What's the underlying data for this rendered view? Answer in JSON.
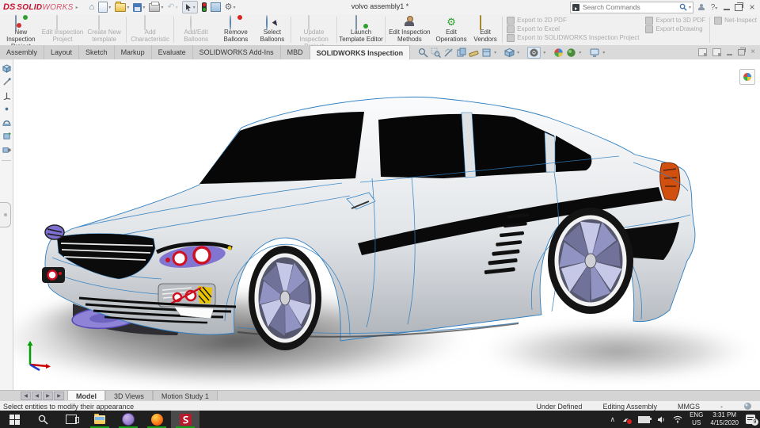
{
  "titlebar": {
    "logo": {
      "mark": "DS",
      "bold": "SOLID",
      "light": "WORKS"
    },
    "title": "volvo assembly1 *",
    "search": {
      "placeholder": "Search Commands"
    }
  },
  "glyphs": {
    "home": "⌂",
    "undo": "↶",
    "gear": "⚙",
    "caret": "▾",
    "expand": "▸",
    "close": "×",
    "chevron_up": "∧",
    "cloud": "☁",
    "prev": "◀",
    "next": "▶",
    "question": "?",
    "collapse_left": "◂"
  },
  "ribbon": {
    "buttons": [
      {
        "label": "New Inspection Project",
        "enabled": true
      },
      {
        "label": "Edit Inspection Project",
        "enabled": false
      },
      {
        "label": "Create New template",
        "enabled": false
      },
      {
        "label": "Add Characteristic",
        "enabled": false
      },
      {
        "label": "Add/Edit Balloons",
        "enabled": false
      },
      {
        "label": "Remove Balloons",
        "enabled": true
      },
      {
        "label": "Select Balloons",
        "enabled": true
      },
      {
        "label": "Update Inspection Project",
        "enabled": false
      },
      {
        "label": "Launch Template Editor",
        "enabled": true
      },
      {
        "label": "Edit Inspection Methods",
        "enabled": true
      },
      {
        "label": "Edit Operations",
        "enabled": true
      },
      {
        "label": "Edit Vendors",
        "enabled": true
      }
    ],
    "export": [
      {
        "label": "Export to 2D PDF"
      },
      {
        "label": "Export to Excel"
      },
      {
        "label": "Export to SOLIDWORKS Inspection Project"
      },
      {
        "label": "Export to 3D PDF"
      },
      {
        "label": "Export eDrawing"
      }
    ],
    "net_inspect": "Net-Inspect"
  },
  "tabs": {
    "items": [
      {
        "label": "Assembly"
      },
      {
        "label": "Layout"
      },
      {
        "label": "Sketch"
      },
      {
        "label": "Markup"
      },
      {
        "label": "Evaluate"
      },
      {
        "label": "SOLIDWORKS Add-Ins"
      },
      {
        "label": "MBD"
      },
      {
        "label": "SOLIDWORKS Inspection"
      }
    ]
  },
  "bottom_tabs": {
    "items": [
      {
        "label": "Model"
      },
      {
        "label": "3D Views"
      },
      {
        "label": "Motion Study 1"
      }
    ]
  },
  "statusbar": {
    "message": "Select entities to modify their appearance",
    "constraint": "Under Defined",
    "mode": "Editing Assembly",
    "units": "MMGS",
    "extra": "-"
  },
  "taskbar": {
    "lang": {
      "line1": "ENG",
      "line2": "US"
    },
    "clock": {
      "time": "3:31 PM",
      "date": "4/15/2020"
    },
    "badge": "9"
  },
  "colors": {
    "accent_red": "#c8102e",
    "edge_blue": "#2f7fc1",
    "wheel_lavender": "#9193c2",
    "taskbar_green": "#19a119"
  }
}
